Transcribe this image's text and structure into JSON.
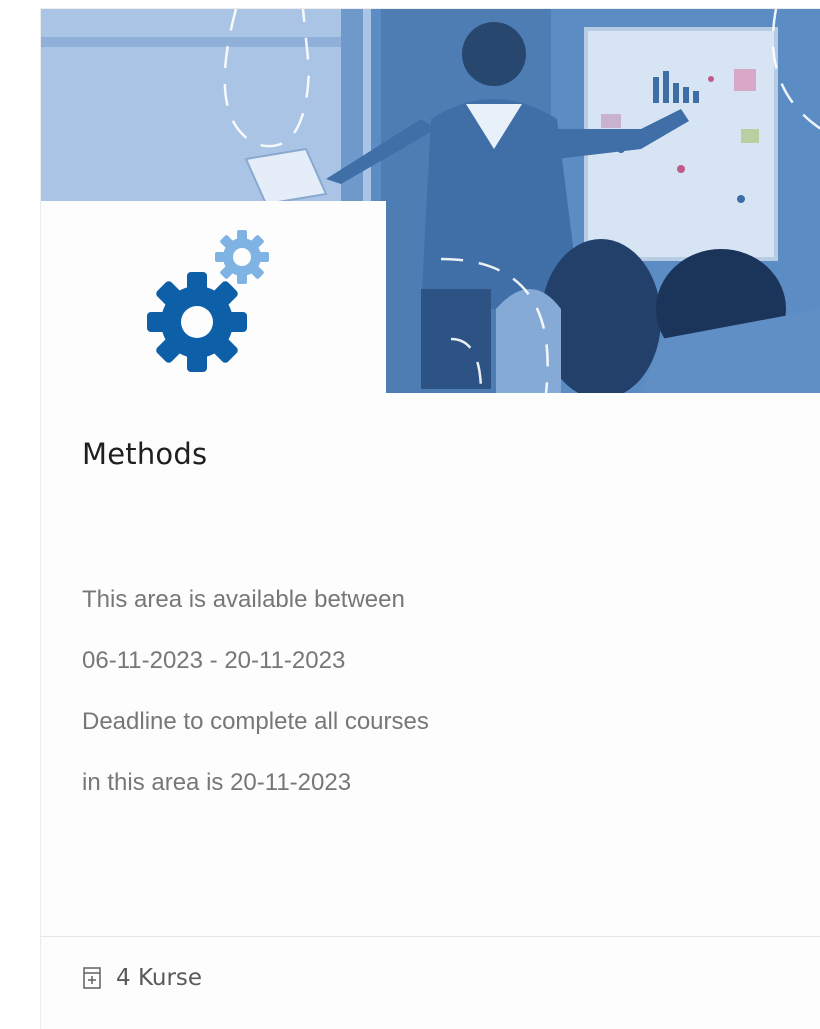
{
  "card": {
    "title": "Methods",
    "description": [
      "This area is available between",
      "06-11-2023 - 20-11-2023",
      "Deadline to complete all courses",
      "in this area is 20-11-2023"
    ],
    "footer": {
      "icon": "document-list-icon",
      "count_label": "4 Kurse"
    }
  },
  "colors": {
    "hero_overlay": "#4a7fb8",
    "gear_primary": "#0d5fa8",
    "gear_secondary": "#7fb3e4",
    "title": "#1f1f1f",
    "text_muted": "#777777"
  }
}
